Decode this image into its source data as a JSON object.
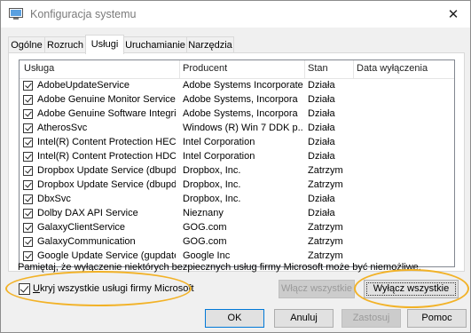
{
  "window": {
    "title": "Konfiguracja systemu"
  },
  "tabs": [
    {
      "label": "Ogólne"
    },
    {
      "label": "Rozruch"
    },
    {
      "label": "Usługi"
    },
    {
      "label": "Uruchamianie"
    },
    {
      "label": "Narzędzia"
    }
  ],
  "active_tab": "Usługi",
  "services": {
    "columns": {
      "name": "Usługa",
      "producer": "Producent",
      "status": "Stan",
      "disabled_date": "Data wyłączenia"
    },
    "rows": [
      {
        "name": "AdobeUpdateService",
        "producer": "Adobe Systems Incorporated",
        "status": "Działa",
        "checked": true
      },
      {
        "name": "Adobe Genuine Monitor Service",
        "producer": "Adobe Systems, Incorpora",
        "status": "Działa",
        "checked": true
      },
      {
        "name": "Adobe Genuine Software Integri...",
        "producer": "Adobe Systems, Incorpora",
        "status": "Działa",
        "checked": true
      },
      {
        "name": "AtherosSvc",
        "producer": "Windows (R) Win 7 DDK p...",
        "status": "Działa",
        "checked": true
      },
      {
        "name": "Intel(R) Content Protection HECI...",
        "producer": "Intel Corporation",
        "status": "Działa",
        "checked": true
      },
      {
        "name": "Intel(R) Content Protection HDC...",
        "producer": "Intel Corporation",
        "status": "Działa",
        "checked": true
      },
      {
        "name": "Dropbox Update Service (dbupd...",
        "producer": "Dropbox, Inc.",
        "status": "Zatrzym",
        "checked": true
      },
      {
        "name": "Dropbox Update Service (dbupd...",
        "producer": "Dropbox, Inc.",
        "status": "Zatrzym",
        "checked": true
      },
      {
        "name": "DbxSvc",
        "producer": "Dropbox, Inc.",
        "status": "Działa",
        "checked": true
      },
      {
        "name": "Dolby DAX API Service",
        "producer": "Nieznany",
        "status": "Działa",
        "checked": true
      },
      {
        "name": "GalaxyClientService",
        "producer": "GOG.com",
        "status": "Zatrzym",
        "checked": true
      },
      {
        "name": "GalaxyCommunication",
        "producer": "GOG.com",
        "status": "Zatrzym",
        "checked": true
      },
      {
        "name": "Google Update Service (gupdate)",
        "producer": "Google Inc",
        "status": "Zatrzym",
        "checked": true
      }
    ]
  },
  "note": "Pamiętaj, że wyłączenie niektórych bezpiecznych usług firmy Microsoft może być niemożliwe.",
  "hide_microsoft": {
    "label": "Ukryj wszystkie usługi firmy Microsoft",
    "checked": true
  },
  "buttons": {
    "enable_all": "Włącz wszystkie",
    "disable_all": "Wyłącz wszystkie",
    "ok": "OK",
    "cancel": "Anuluj",
    "apply": "Zastosuj",
    "help": "Pomoc"
  },
  "colors": {
    "highlight_ring": "#f2b227",
    "accent": "#0078d7"
  }
}
